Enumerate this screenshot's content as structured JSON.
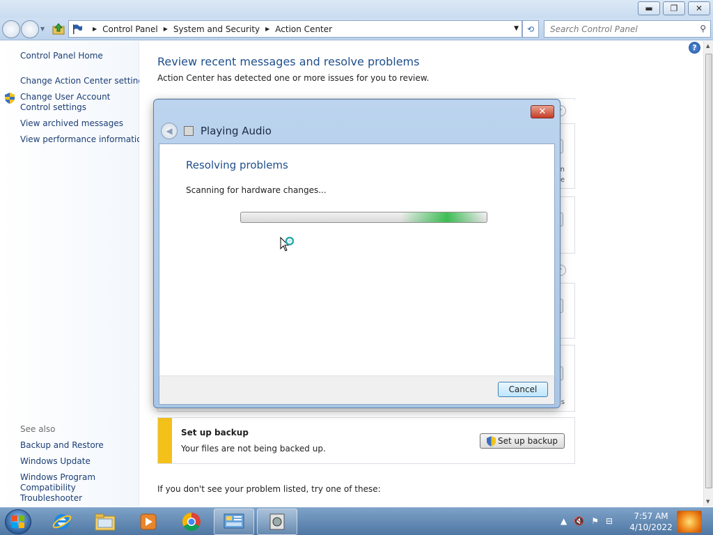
{
  "window": {
    "minimize_label": "▬",
    "maximize_label": "❐",
    "close_label": "✕"
  },
  "address": {
    "breadcrumb": [
      "Control Panel",
      "System and Security",
      "Action Center"
    ],
    "search_placeholder": "Search Control Panel"
  },
  "sidebar": {
    "items": [
      "Control Panel Home",
      "Change Action Center settings",
      "Change User Account Control settings",
      "View archived messages",
      "View performance information"
    ],
    "see_also_label": "See also",
    "see_also": [
      "Backup and Restore",
      "Windows Update",
      "Windows Program Compatibility Troubleshooter"
    ]
  },
  "main": {
    "heading": "Review recent messages and resolve problems",
    "subheading": "Action Center has detected one or more issues for you to review.",
    "partial_right_text": [
      "n",
      "e",
      "s"
    ],
    "backup": {
      "title": "Set up backup",
      "text": "Your files are not being backed up.",
      "button_label": "Set up backup"
    },
    "try_these": "If you don't see your problem listed, try one of these:"
  },
  "dialog": {
    "title": "Playing Audio",
    "heading": "Resolving problems",
    "status": "Scanning for hardware changes...",
    "progress_state": "indeterminate",
    "cancel_label": "Cancel",
    "close_label": "✕"
  },
  "taskbar": {
    "time": "7:57 AM",
    "date": "4/10/2022",
    "apps": [
      "start-orb",
      "internet-explorer",
      "windows-explorer",
      "media-player",
      "chrome",
      "control-panel",
      "troubleshooter"
    ]
  },
  "colors": {
    "link": "#1a3d74",
    "heading": "#1e4e8c",
    "warning_bar": "#f4c01a",
    "progress_glow": "#06b025"
  }
}
